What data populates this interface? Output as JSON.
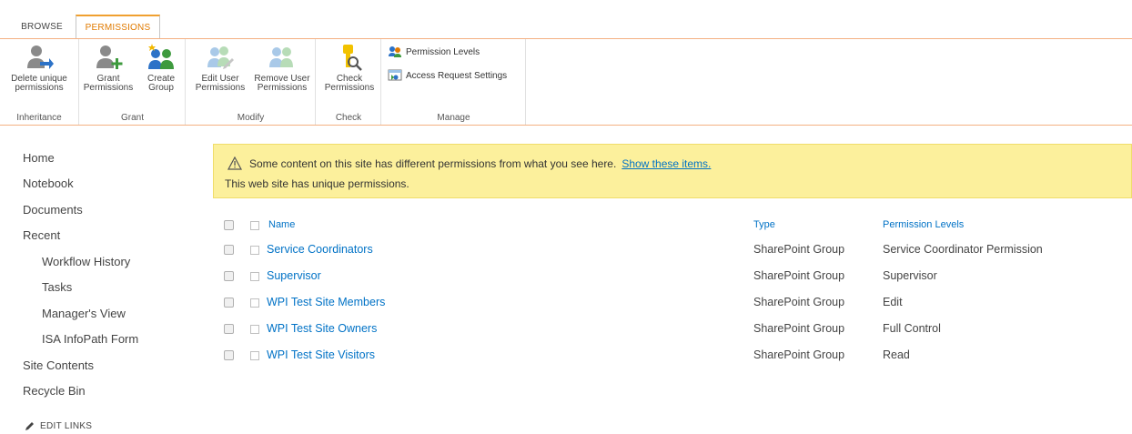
{
  "tabs": [
    {
      "label": "BROWSE"
    },
    {
      "label": "PERMISSIONS"
    }
  ],
  "ribbon": {
    "groups": {
      "inheritance": "Inheritance",
      "grant": "Grant",
      "modify": "Modify",
      "check": "Check",
      "manage": "Manage"
    },
    "buttons": {
      "delete_unique_1": "Delete unique",
      "delete_unique_2": "permissions",
      "grant_1": "Grant",
      "grant_2": "Permissions",
      "create_1": "Create",
      "create_2": "Group",
      "edit_user_1": "Edit User",
      "edit_user_2": "Permissions",
      "remove_user_1": "Remove User",
      "remove_user_2": "Permissions",
      "check_1": "Check",
      "check_2": "Permissions",
      "permission_levels": "Permission Levels",
      "access_request": "Access Request Settings"
    }
  },
  "nav": {
    "items": [
      {
        "label": "Home"
      },
      {
        "label": "Notebook"
      },
      {
        "label": "Documents"
      },
      {
        "label": "Recent"
      },
      {
        "label": "Workflow History"
      },
      {
        "label": "Tasks"
      },
      {
        "label": "Manager's View"
      },
      {
        "label": "ISA InfoPath Form"
      },
      {
        "label": "Site Contents"
      },
      {
        "label": "Recycle Bin"
      }
    ],
    "edit_links": "EDIT LINKS"
  },
  "banner": {
    "message": "Some content on this site has different permissions from what you see here.",
    "link": "Show these items.",
    "unique": "This web site has unique permissions."
  },
  "table": {
    "headers": {
      "name": "Name",
      "type": "Type",
      "levels": "Permission Levels"
    },
    "rows": [
      {
        "name": "Service Coordinators",
        "type": "SharePoint Group",
        "levels": "Service Coordinator Permission"
      },
      {
        "name": "Supervisor",
        "type": "SharePoint Group",
        "levels": "Supervisor"
      },
      {
        "name": "WPI Test Site Members",
        "type": "SharePoint Group",
        "levels": "Edit"
      },
      {
        "name": "WPI Test Site Owners",
        "type": "SharePoint Group",
        "levels": "Full Control"
      },
      {
        "name": "WPI Test Site Visitors",
        "type": "SharePoint Group",
        "levels": "Read"
      }
    ]
  },
  "colors": {
    "accent": "#e07a00",
    "link": "#0072c6",
    "banner": "#fcf09c"
  }
}
